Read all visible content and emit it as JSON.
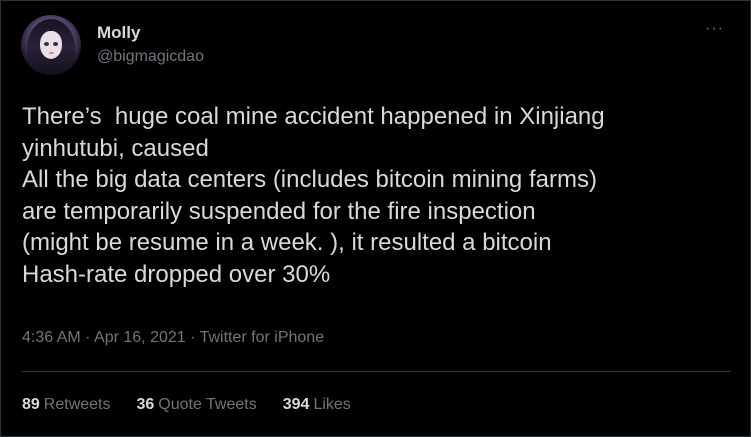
{
  "author": {
    "name": "Molly",
    "handle": "@bigmagicdao"
  },
  "tweet": {
    "text": "There’s  huge coal mine accident happened in Xinjiang\nyinhutubi, caused\nAll the big data centers (includes bitcoin mining farms)\nare temporarily suspended for the fire inspection\n(might be resume in a week. ), it resulted a bitcoin\nHash-rate dropped over 30%",
    "meta": "4:36 AM · Apr 16, 2021 · Twitter for iPhone"
  },
  "menu": {
    "icon": "more-horizontal-icon",
    "glyph": "···"
  },
  "stats": {
    "retweets": {
      "count": "89",
      "label": "Retweets"
    },
    "quotes": {
      "count": "36",
      "label": "Quote Tweets"
    },
    "likes": {
      "count": "394",
      "label": "Likes"
    }
  },
  "colors": {
    "background": "#000000",
    "text": "#d9d9d9",
    "secondary": "#6e767d",
    "border": "#2f3336"
  }
}
